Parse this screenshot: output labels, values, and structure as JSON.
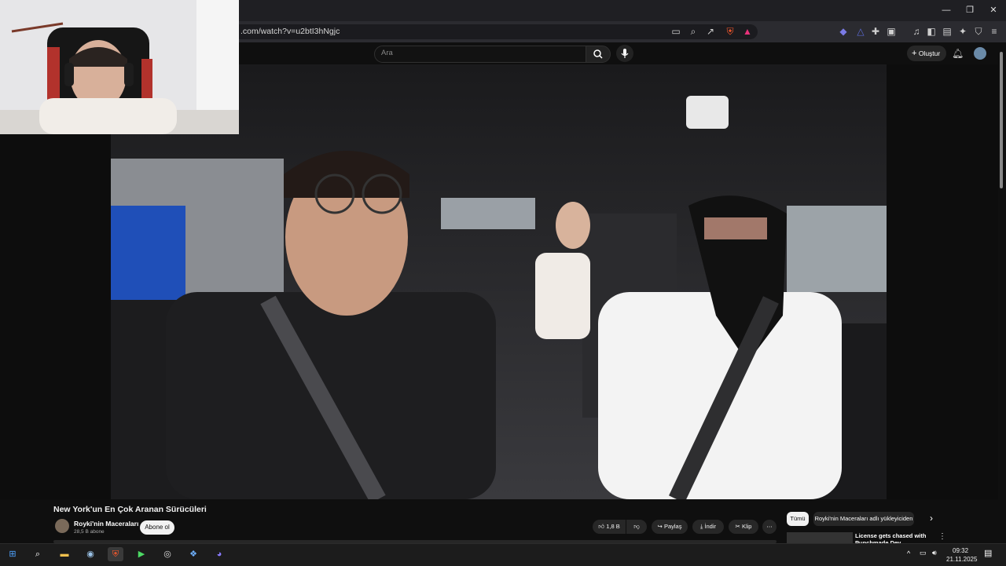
{
  "browser": {
    "url": ".com/watch?v=u2btI3hNgjc",
    "icons": [
      "cast-icon",
      "zoom-icon",
      "share-icon",
      "brave-shield-icon",
      "brave-rewards-icon"
    ],
    "window_controls": {
      "minimize": "—",
      "restore": "❐",
      "close": "✕"
    }
  },
  "youtube": {
    "search_placeholder": "Ara",
    "create_label": "Oluştur"
  },
  "video": {
    "title": "New York'un En Çok Aranan Sürücüleri",
    "channel_name": "Royki'nin Maceraları",
    "subscribers": "28,5 B abone",
    "subscribe_label": "Abone ol",
    "likes": "1,8 B",
    "share_label": "Paylaş",
    "download_label": "İndir",
    "clip_label": "Klip",
    "more_label": "⋯"
  },
  "recommendations": {
    "chips": [
      "Tümü",
      "Royki'nin Maceraları adlı yükleyiciden"
    ],
    "next_chevron": "›",
    "first_title": "License gets chased with Punchmade Dev"
  },
  "taskbar": {
    "time": "09:32",
    "date": "21.11.2025"
  }
}
